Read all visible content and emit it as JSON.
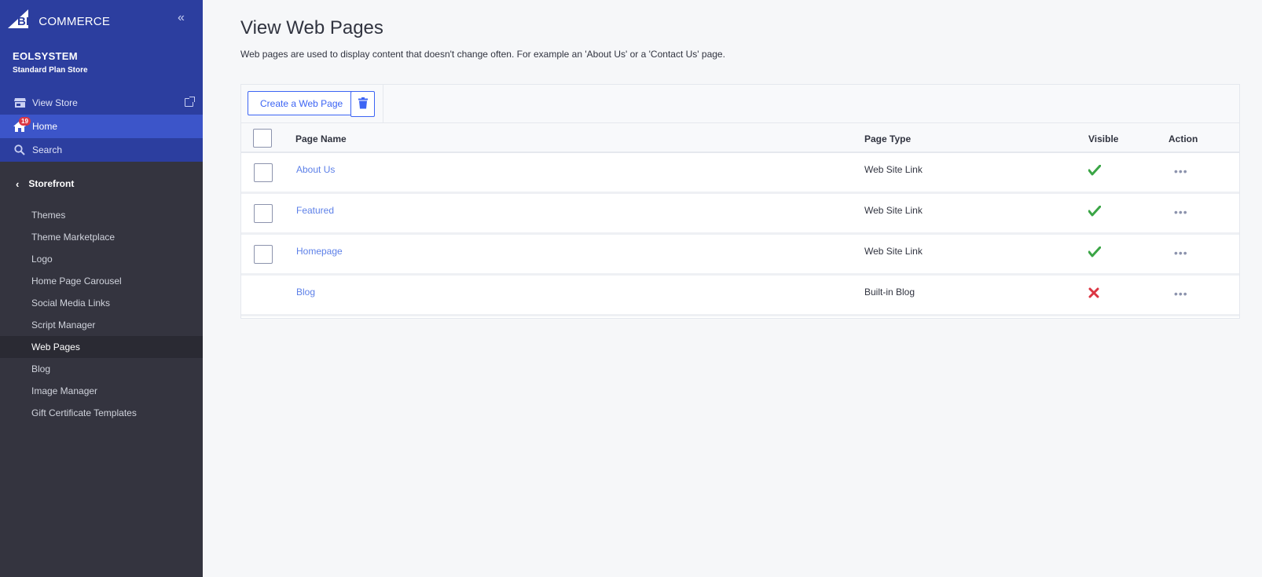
{
  "sidebar": {
    "logo": {
      "big": "BIG",
      "rest": "COMMERCE"
    },
    "store_name": "EOLSYSTEM",
    "store_plan": "Standard Plan Store",
    "view_store": "View Store",
    "home": "Home",
    "home_badge": "19",
    "search": "Search",
    "section": "Storefront",
    "items": [
      {
        "label": "Themes"
      },
      {
        "label": "Theme Marketplace"
      },
      {
        "label": "Logo"
      },
      {
        "label": "Home Page Carousel"
      },
      {
        "label": "Social Media Links"
      },
      {
        "label": "Script Manager"
      },
      {
        "label": "Web Pages"
      },
      {
        "label": "Blog"
      },
      {
        "label": "Image Manager"
      },
      {
        "label": "Gift Certificate Templates"
      }
    ],
    "active_item": "Web Pages"
  },
  "main": {
    "title": "View Web Pages",
    "description": "Web pages are used to display content that doesn't change often. For example an 'About Us' or a 'Contact Us' page.",
    "toolbar": {
      "create_label": "Create a Web Page"
    },
    "table": {
      "headers": {
        "name": "Page Name",
        "type": "Page Type",
        "visible": "Visible",
        "action": "Action"
      },
      "rows": [
        {
          "name": "About Us",
          "type": "Web Site Link",
          "visible": true,
          "selectable": true
        },
        {
          "name": "Featured",
          "type": "Web Site Link",
          "visible": true,
          "selectable": true
        },
        {
          "name": "Homepage",
          "type": "Web Site Link",
          "visible": true,
          "selectable": true
        },
        {
          "name": "Blog",
          "type": "Built-in Blog",
          "visible": false,
          "selectable": false
        }
      ]
    }
  },
  "colors": {
    "sidebar_top": "#2c3e9f",
    "sidebar": "#34343f",
    "accent": "#3c64f4",
    "link": "#5d80e8",
    "check": "#3aa545",
    "cross": "#db3643"
  }
}
